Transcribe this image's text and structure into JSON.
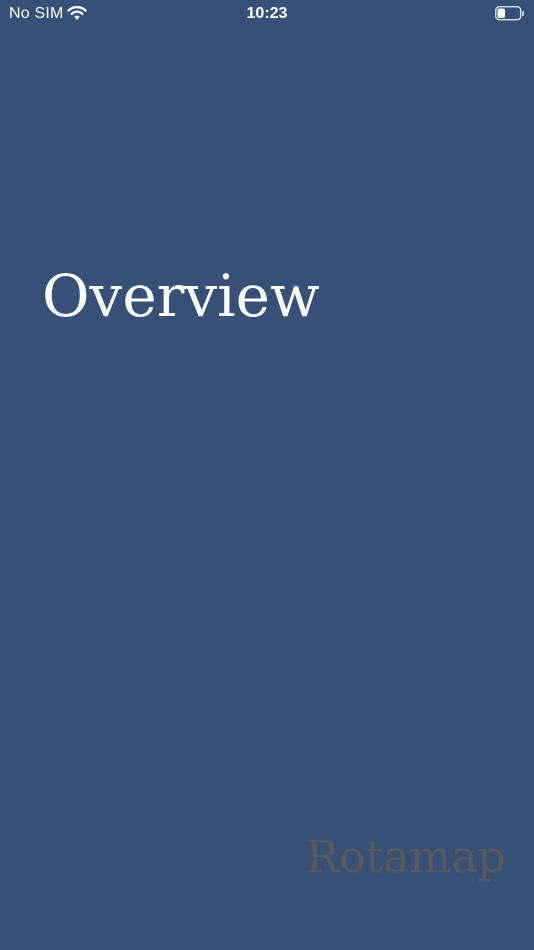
{
  "status_bar": {
    "carrier": "No SIM",
    "time": "10:23",
    "wifi_icon": "wifi-icon",
    "battery_icon": "battery-icon",
    "battery_level": 0.35
  },
  "screen": {
    "title": "Overview",
    "background_color": "#365078"
  },
  "branding": {
    "logo_text": "Rotamap",
    "color": "#5a5a5a"
  }
}
